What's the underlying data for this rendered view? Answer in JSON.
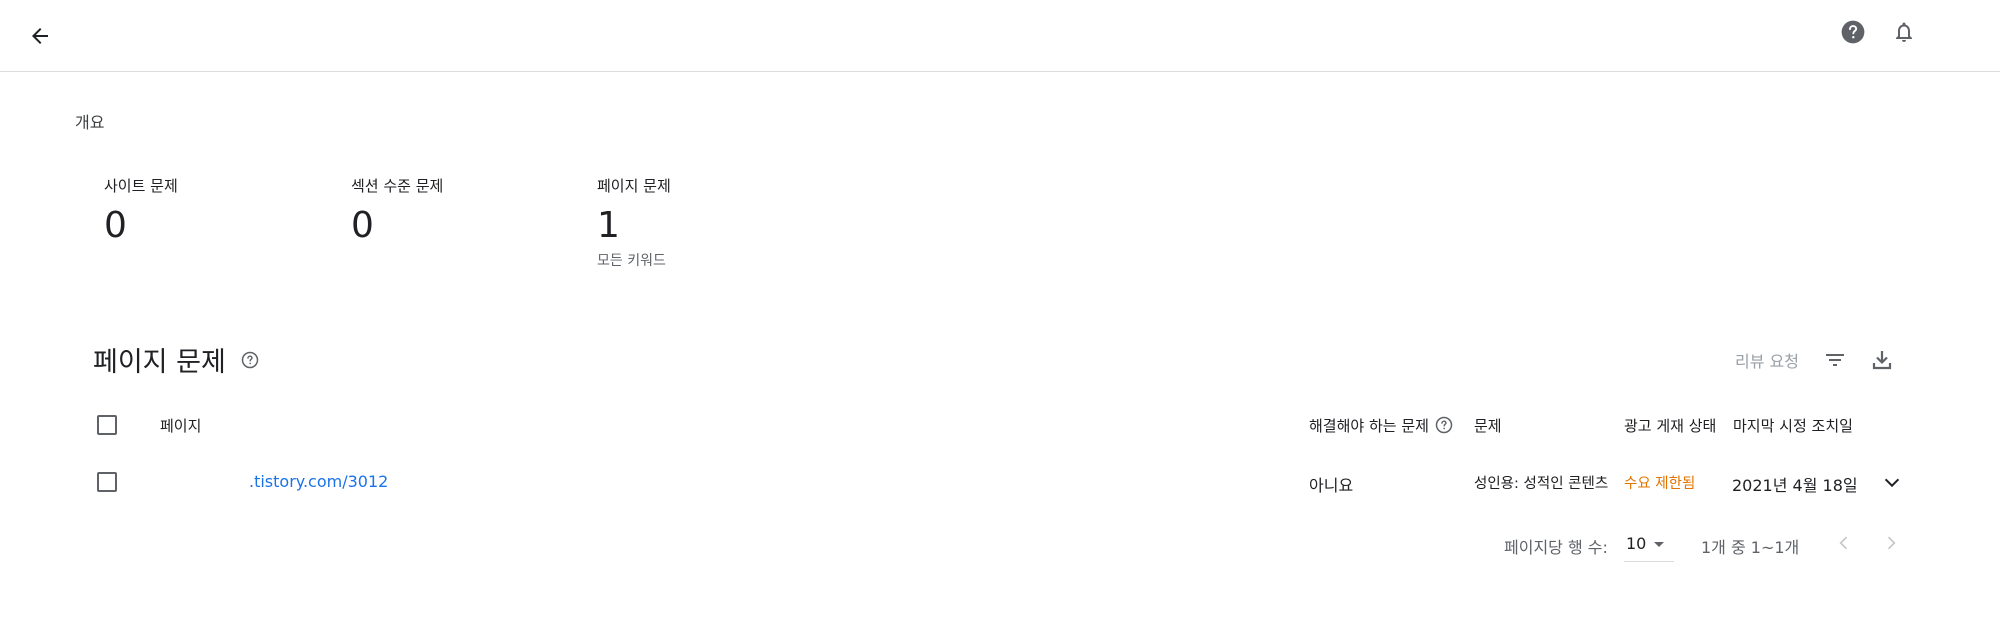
{
  "header": {
    "back_icon": "arrow-back-icon",
    "help_icon": "help-circle-icon",
    "notifications_icon": "bell-icon"
  },
  "overview": {
    "label": "개요",
    "stats": [
      {
        "label": "사이트 문제",
        "value": "0"
      },
      {
        "label": "섹션 수준 문제",
        "value": "0"
      },
      {
        "label": "페이지 문제",
        "value": "1",
        "sub": "모든 키워드"
      }
    ]
  },
  "page_issues": {
    "title": "페이지 문제",
    "review_label": "리뷰 요청",
    "columns": {
      "page": "페이지",
      "must_fix": "해결해야 하는 문제",
      "issue": "문제",
      "ad_serving": "광고 게재 상태",
      "last_action": "마지막 시정 조치일"
    },
    "rows": [
      {
        "page": ".tistory.com/3012",
        "must_fix": "아니요",
        "issue": "성인용: 성적인 콘텐츠",
        "ad_serving": "수요 제한됨",
        "last_action": "2021년 4월 18일"
      }
    ],
    "pagination": {
      "rows_per_page_label": "페이지당 행 수:",
      "rows_per_page_value": "10",
      "range_label": "1개 중 1~1개"
    }
  },
  "colors": {
    "link": "#1a73e8",
    "warning": "#e37400",
    "disabled": "#9aa0a6",
    "divider": "#dadce0"
  }
}
